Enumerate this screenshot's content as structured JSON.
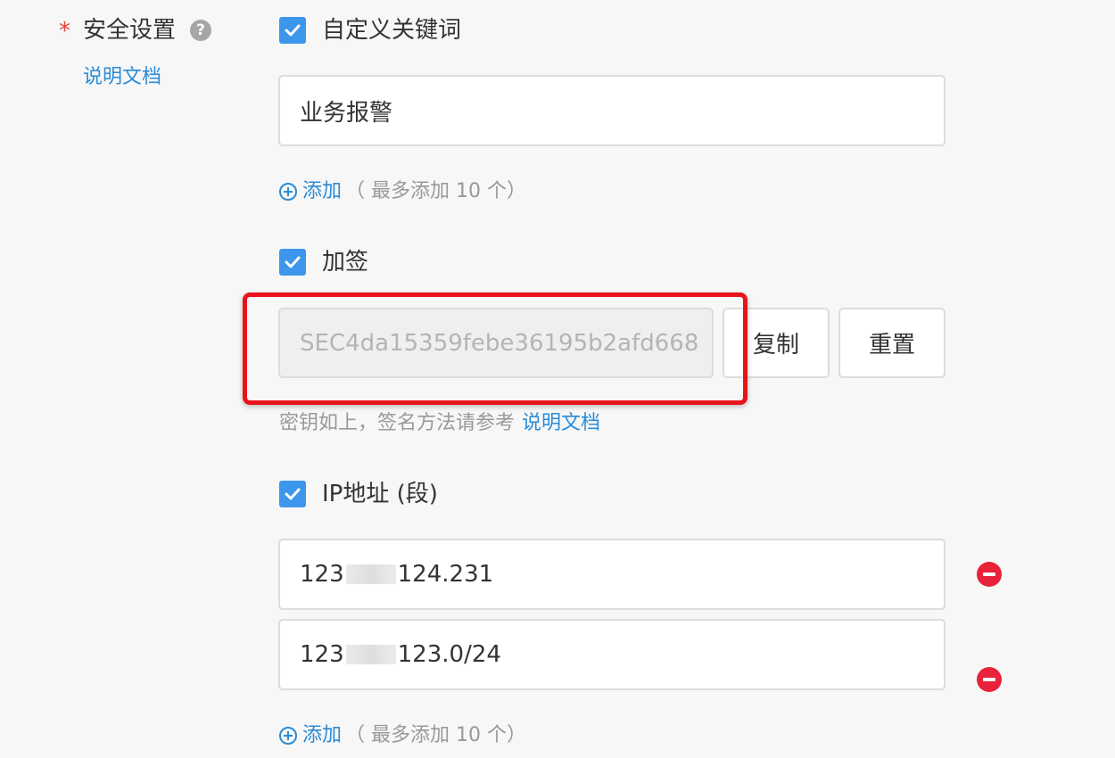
{
  "security": {
    "required_mark": "*",
    "label": "安全设置",
    "help_icon": "question-circle-icon",
    "help_glyph": "?",
    "doc_link": "说明文档"
  },
  "keyword": {
    "checkbox_label": "自定义关键词",
    "checked": true,
    "input_value": "业务报警",
    "add_label": "添加",
    "add_hint": "（ 最多添加 10 个）"
  },
  "signature": {
    "checkbox_label": "加签",
    "checked": true,
    "secret_value": "SEC4da15359febe36195b2afd668",
    "copy_button": "复制",
    "reset_button": "重置",
    "hint": "密钥如上，签名方法请参考",
    "hint_link": "说明文档"
  },
  "ip": {
    "checkbox_label": "IP地址 (段)",
    "checked": true,
    "entries": [
      {
        "prefix": "123",
        "suffix": "124.231"
      },
      {
        "prefix": "123",
        "suffix": "123.0/24"
      }
    ],
    "add_label": "添加",
    "add_hint": "（ 最多添加 10 个）"
  },
  "colors": {
    "accent": "#3b96ec",
    "link": "#2a8bd6",
    "danger": "#e8223a",
    "highlight": "#e8141b"
  }
}
